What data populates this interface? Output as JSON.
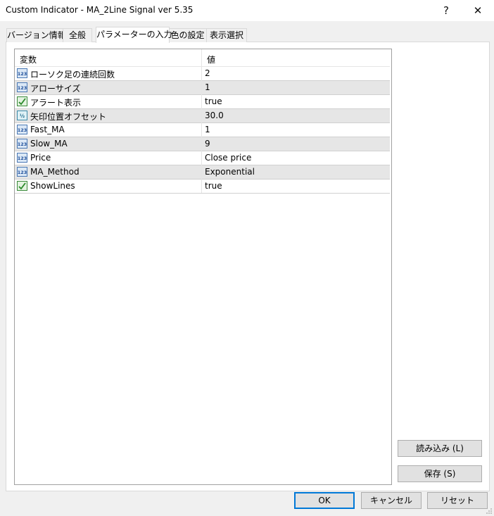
{
  "window": {
    "title": "Custom Indicator - MA_2Line Signal ver 5.35",
    "help_glyph": "?",
    "close_glyph": "✕"
  },
  "tabs": [
    {
      "label": "バージョン情報"
    },
    {
      "label": "全般"
    },
    {
      "label": "パラメーターの入力",
      "active": true
    },
    {
      "label": "色の設定"
    },
    {
      "label": "表示選択"
    }
  ],
  "grid": {
    "headers": {
      "name": "変数",
      "value": "値"
    },
    "rows": [
      {
        "icon": "int-icon",
        "name": "ローソク足の連続回数",
        "value": "2"
      },
      {
        "icon": "int-icon",
        "name": "アローサイズ",
        "value": "1"
      },
      {
        "icon": "bool-icon",
        "name": "アラート表示",
        "value": "true"
      },
      {
        "icon": "double-icon",
        "name": "矢印位置オフセット",
        "value": "30.0"
      },
      {
        "icon": "int-icon",
        "name": "Fast_MA",
        "value": "1"
      },
      {
        "icon": "int-icon",
        "name": "Slow_MA",
        "value": "9"
      },
      {
        "icon": "int-icon",
        "name": "Price",
        "value": "Close price"
      },
      {
        "icon": "int-icon",
        "name": "MA_Method",
        "value": "Exponential"
      },
      {
        "icon": "bool-icon",
        "name": "ShowLines",
        "value": "true"
      }
    ]
  },
  "side_buttons": {
    "load": "読み込み (L)",
    "save": "保存 (S)"
  },
  "footer_buttons": {
    "ok": "OK",
    "cancel": "キャンセル",
    "reset": "リセット"
  },
  "colors": {
    "accent": "#0078d7",
    "row_alt": "#e6e6e6"
  }
}
